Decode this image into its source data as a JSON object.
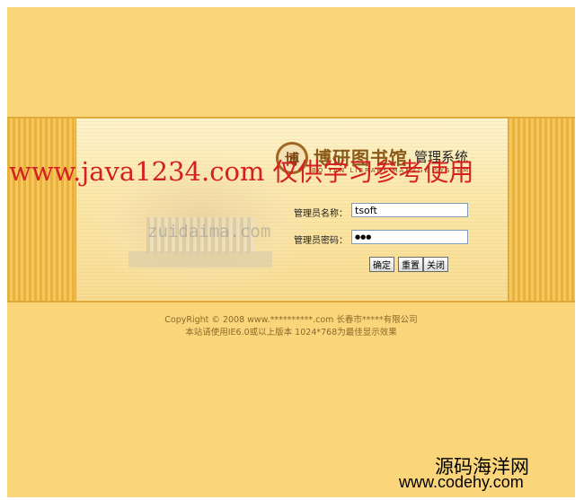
{
  "logo": {
    "seal_char": "博",
    "title_cn": "博研图书馆",
    "title_system": "管理系统",
    "title_en": "BO YAN LIBRARY  MANAGE SYSTEM"
  },
  "login": {
    "username_label": "管理员名称：",
    "username_value": "tsoft",
    "password_label": "管理员密码：",
    "password_value": "●●●",
    "confirm_label": "确定",
    "reset_label": "重置",
    "close_label": "关闭"
  },
  "footer": {
    "copyright": "CopyRight © 2008 www.**********.com 长春市*****有限公司",
    "notice": "本站请使用IE6.0或以上版本 1024*768为最佳显示效果"
  },
  "watermarks": {
    "red_url": "www.java1234.com",
    "red_cn": " 仅供学习参考使用",
    "gray": "zuidaima.com",
    "site_cn": "源码海洋网",
    "site_url": "www.codehy.com"
  },
  "colors": {
    "page_bg": "#fad57a",
    "watermark_red": "#d42020"
  }
}
